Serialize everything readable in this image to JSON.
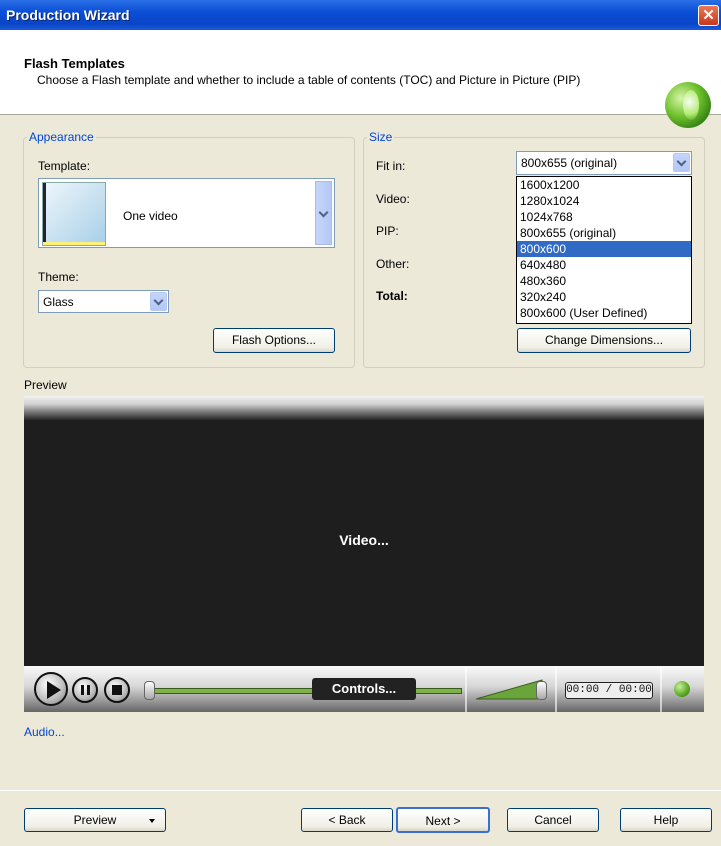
{
  "window": {
    "title": "Production Wizard",
    "close_glyph": "✕"
  },
  "header": {
    "title": "Flash Templates",
    "description": "Choose a Flash template and whether to include a table of contents (TOC) and Picture in Picture (PIP)",
    "logo_icon": "camtasia-logo-icon"
  },
  "appearance": {
    "legend": "Appearance",
    "template_label": "Template:",
    "template_value": "One video",
    "theme_label": "Theme:",
    "theme_value": "Glass",
    "flash_options_button": "Flash Options..."
  },
  "size": {
    "legend": "Size",
    "fit_in_label": "Fit in:",
    "fit_in_value": "800x655 (original)",
    "video_label": "Video:",
    "pip_label": "PIP:",
    "other_label": "Other:",
    "total_label": "Total:",
    "options": [
      "1600x1200",
      "1280x1024",
      "1024x768",
      "800x655 (original)",
      "800x600",
      "640x480",
      "480x360",
      "320x240",
      "800x600 (User Defined)"
    ],
    "selected_option": "800x600",
    "change_dimensions_button": "Change Dimensions..."
  },
  "preview": {
    "label": "Preview",
    "video_text": "Video...",
    "controls_text": "Controls...",
    "time_text": "00:00 / 00:00"
  },
  "audio_link": "Audio...",
  "buttons": {
    "preview": "Preview",
    "back": "< Back",
    "next": "Next >",
    "cancel": "Cancel",
    "help": "Help"
  },
  "colors": {
    "selection": "#316ac5",
    "link": "#0046d5",
    "titlebar": "#0a4ed6"
  }
}
